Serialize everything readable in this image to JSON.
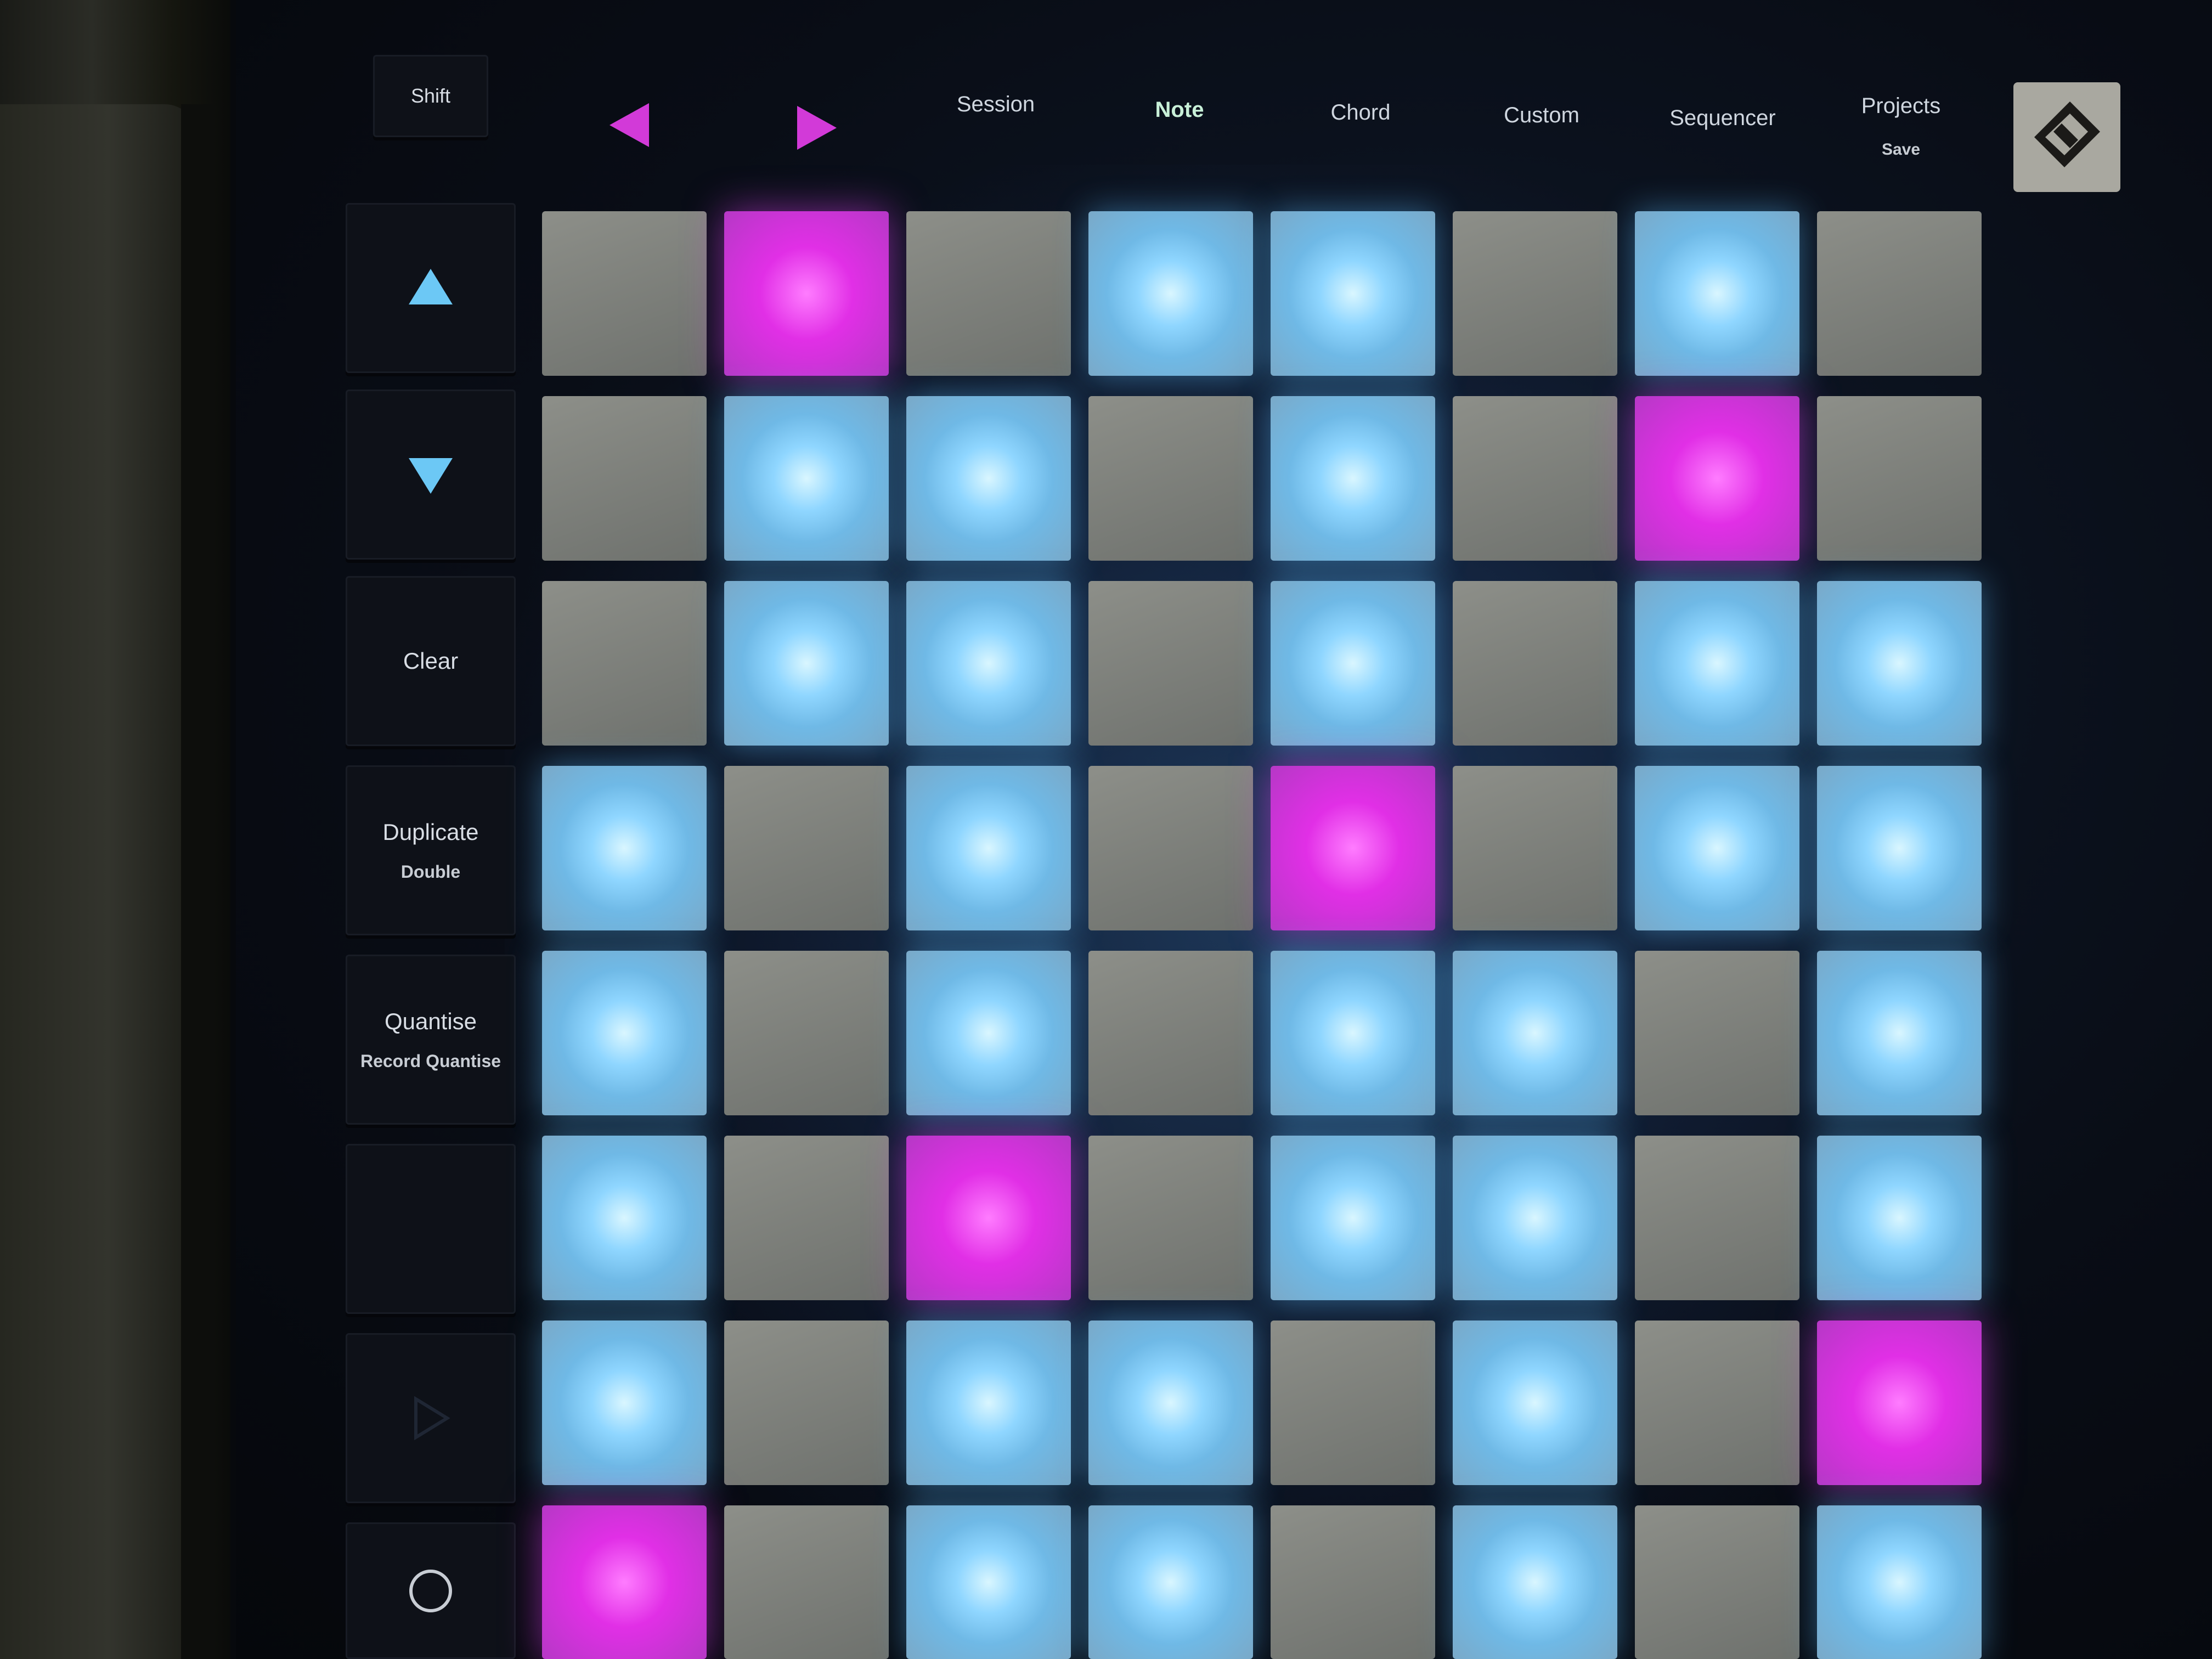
{
  "top_row": {
    "shift": "Shift",
    "session": "Session",
    "note": "Note",
    "chord": "Chord",
    "custom": "Custom",
    "sequencer": "Sequencer",
    "projects": "Projects",
    "projects_sub": "Save"
  },
  "side_column": {
    "clear": "Clear",
    "duplicate": "Duplicate",
    "duplicate_sub": "Double",
    "quantise": "Quantise",
    "quantise_sub": "Record Quantise"
  },
  "colors": {
    "pad_blue": "#8fd6ff",
    "pad_pink": "#e12fe6",
    "pad_off": "#7b7e79",
    "arrow_pink": "#d23ad8",
    "arrow_blue": "#6cc8f5"
  },
  "grid": [
    [
      "off",
      "pink",
      "off",
      "blue",
      "blue",
      "off",
      "blue",
      "off"
    ],
    [
      "off",
      "blue",
      "blue",
      "off",
      "blue",
      "off",
      "pink",
      "off"
    ],
    [
      "off",
      "blue",
      "blue",
      "off",
      "blue",
      "off",
      "blue",
      "blue"
    ],
    [
      "blue",
      "off",
      "blue",
      "off",
      "pink",
      "off",
      "blue",
      "blue"
    ],
    [
      "blue",
      "off",
      "blue",
      "off",
      "blue",
      "blue",
      "off",
      "blue"
    ],
    [
      "blue",
      "off",
      "pink",
      "off",
      "blue",
      "blue",
      "off",
      "blue"
    ],
    [
      "blue",
      "off",
      "blue",
      "blue",
      "off",
      "blue",
      "off",
      "pink"
    ],
    [
      "pink",
      "off",
      "blue",
      "blue",
      "off",
      "blue",
      "off",
      "blue"
    ]
  ],
  "icons": [
    "left-arrow-icon",
    "right-arrow-icon",
    "up-arrow-icon",
    "down-arrow-icon",
    "play-icon",
    "circle-record-icon",
    "novation-logo-icon"
  ]
}
